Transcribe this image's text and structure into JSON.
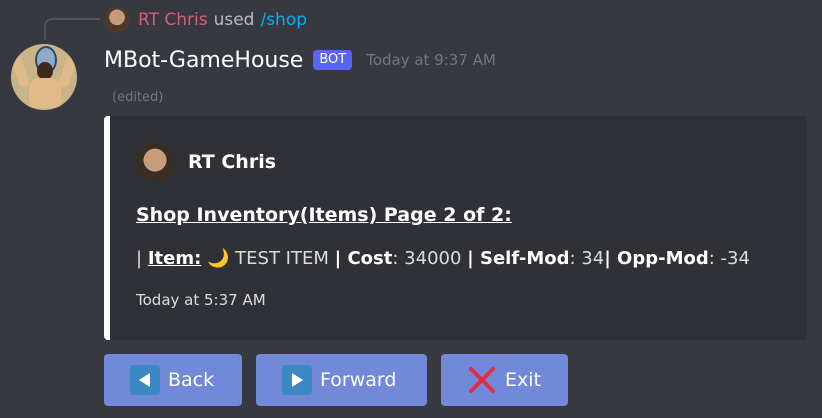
{
  "reply": {
    "name": "RT Chris",
    "used": "used",
    "command": "/shop"
  },
  "message": {
    "username": "MBot-GameHouse",
    "bot_tag": "BOT",
    "timestamp": "Today at 9:37 AM",
    "edited": "(edited)"
  },
  "embed": {
    "author": "RT Chris",
    "title": "Shop Inventory(Items) Page 2 of 2:",
    "description": {
      "pipe_start": "|",
      "item_label": "Item:",
      "item_emoji": "🌙",
      "item_name": "TEST ITEM",
      "cost_label": "| Cost",
      "cost_value": ": 34000",
      "selfmod_label": "| Self-Mod",
      "selfmod_value": ": 34",
      "oppmod_label": "| Opp-Mod",
      "oppmod_value": ": -34"
    },
    "footer": "Today at 5:37 AM",
    "accent_color": "#ffffff"
  },
  "buttons": [
    {
      "label": "Back",
      "icon": "back-arrow-icon"
    },
    {
      "label": "Forward",
      "icon": "forward-arrow-icon"
    },
    {
      "label": "Exit",
      "icon": "close-x-icon"
    }
  ]
}
